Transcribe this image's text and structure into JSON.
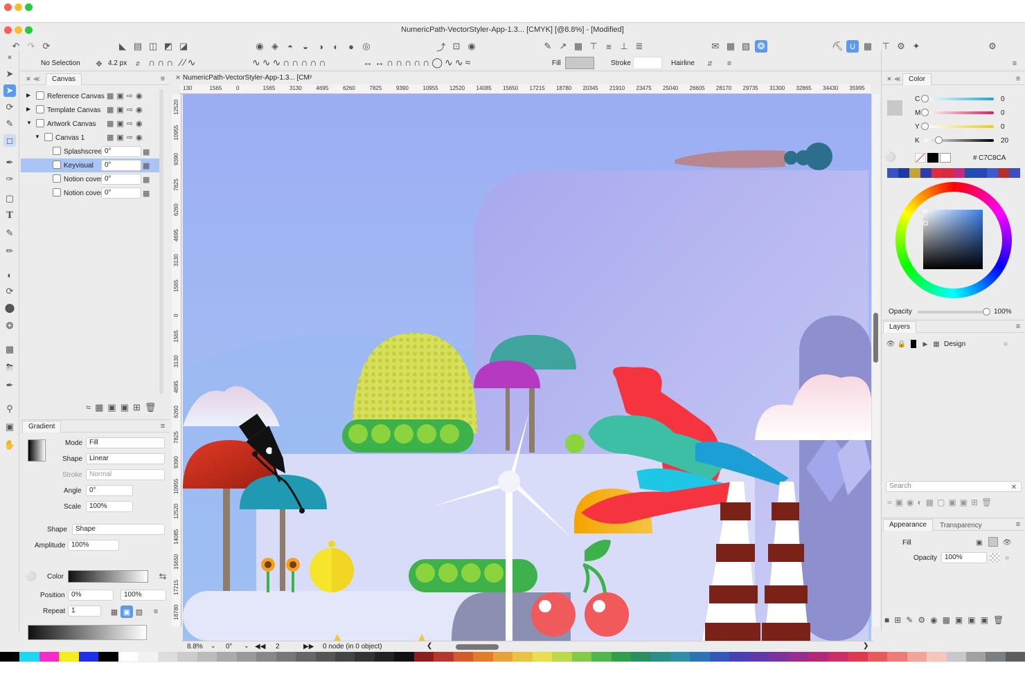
{
  "window": {
    "title": "NumericPath-VectorStyler-App-1.3... [CMYK] [@8.8%] - [Modified]",
    "doc_tab": "NumericPath-VectorStyler-App-1.3... [CMʸ"
  },
  "toolbar": {
    "selection": "No Selection",
    "stroke_width": "4.2 px",
    "fill_label": "Fill",
    "stroke_label": "Stroke",
    "stroke_style": "Hairline"
  },
  "canvas_panel": {
    "tab": "Canvas",
    "items": [
      {
        "label": "Reference Canvas",
        "level": 0,
        "expand": "▶"
      },
      {
        "label": "Template Canvas",
        "level": 0,
        "expand": "▶"
      },
      {
        "label": "Artwork Canvas",
        "level": 0,
        "expand": "▼"
      },
      {
        "label": "Canvas 1",
        "level": 1,
        "expand": "▼"
      },
      {
        "label": "Splashscreen",
        "level": 2,
        "angle": "0°"
      },
      {
        "label": "Keyvisual",
        "level": 2,
        "angle": "0°",
        "selected": true
      },
      {
        "label": "Notion cover",
        "level": 2,
        "angle": "0°"
      },
      {
        "label": "Notion cover",
        "level": 2,
        "angle": "0°"
      }
    ]
  },
  "gradient_panel": {
    "tab": "Gradient",
    "mode_label": "Mode",
    "mode": "Fill",
    "shape_label": "Shape",
    "shape": "Linear",
    "stroke_label": "Stroke",
    "stroke": "Normal",
    "angle_label": "Angle",
    "angle": "0°",
    "scale_label": "Scale",
    "scale": "100%",
    "shape2_label": "Shape",
    "shape2": "Shape",
    "amplitude_label": "Amplitude",
    "amplitude": "100%",
    "color_label": "Color",
    "position_label": "Position",
    "position_a": "0%",
    "position_b": "100%",
    "repeat_label": "Repeat",
    "repeat": "1"
  },
  "ruler_h": [
    "130",
    "1565",
    "0",
    "1565",
    "3130",
    "4695",
    "6260",
    "7825",
    "9390",
    "10955",
    "12520",
    "14085",
    "15650",
    "17215",
    "18780",
    "20345",
    "21910",
    "23475",
    "25040",
    "26605",
    "28170",
    "29735",
    "31300",
    "32865",
    "34430",
    "35995"
  ],
  "ruler_v": [
    "12520",
    "10955",
    "9390",
    "7825",
    "6260",
    "4695",
    "3130",
    "1565",
    "0",
    "1565",
    "3130",
    "4695",
    "6260",
    "7825",
    "9390",
    "10955",
    "12520",
    "14085",
    "15650",
    "17215",
    "18780"
  ],
  "status": {
    "zoom": "8.8%",
    "angle": "0°",
    "page": "2",
    "nodes": "0 node (in 0 object)"
  },
  "color_panel": {
    "tab": "Color",
    "channels": [
      {
        "label": "C",
        "value": "0",
        "level": 0
      },
      {
        "label": "M",
        "value": "0",
        "level": 0
      },
      {
        "label": "Y",
        "value": "0",
        "level": 0
      },
      {
        "label": "K",
        "value": "20",
        "level": 0.2
      }
    ],
    "hex_prefix": "#",
    "hex": "C7C8CA",
    "opacity_label": "Opacity",
    "opacity": "100%"
  },
  "layers_panel": {
    "tab": "Layers",
    "layers": [
      {
        "name": "Design"
      }
    ],
    "search_placeholder": "Search"
  },
  "appearance_panel": {
    "tab": "Appearance",
    "tab2": "Transparency",
    "fill_label": "Fill",
    "opacity_label": "Opacity",
    "opacity": "100%"
  },
  "colors": {
    "accent": "#5b9bef",
    "selection_row": "#a9c4f5",
    "sky_top": "#9fb0f2",
    "sky_bottom": "#8fb6f5"
  }
}
